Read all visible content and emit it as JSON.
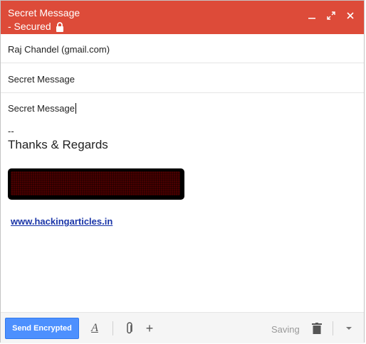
{
  "window": {
    "title_line1": "Secret Message",
    "title_line2": "- Secured",
    "controls": [
      "minimize-icon",
      "expand-icon",
      "close-icon"
    ],
    "header_color": "#dd4b39"
  },
  "compose": {
    "recipients": "Raj Chandel (gmail.com)",
    "subject": "Secret Message",
    "body_text": "Secret Message",
    "signature": {
      "dash": "--",
      "regards": "Thanks & Regards",
      "link": "www.hackingarticles.in"
    }
  },
  "footer": {
    "send_label": "Send Encrypted",
    "format_icon_glyph": "A",
    "plus_glyph": "+",
    "status": "Saving",
    "send_color": "#4d90fe"
  }
}
